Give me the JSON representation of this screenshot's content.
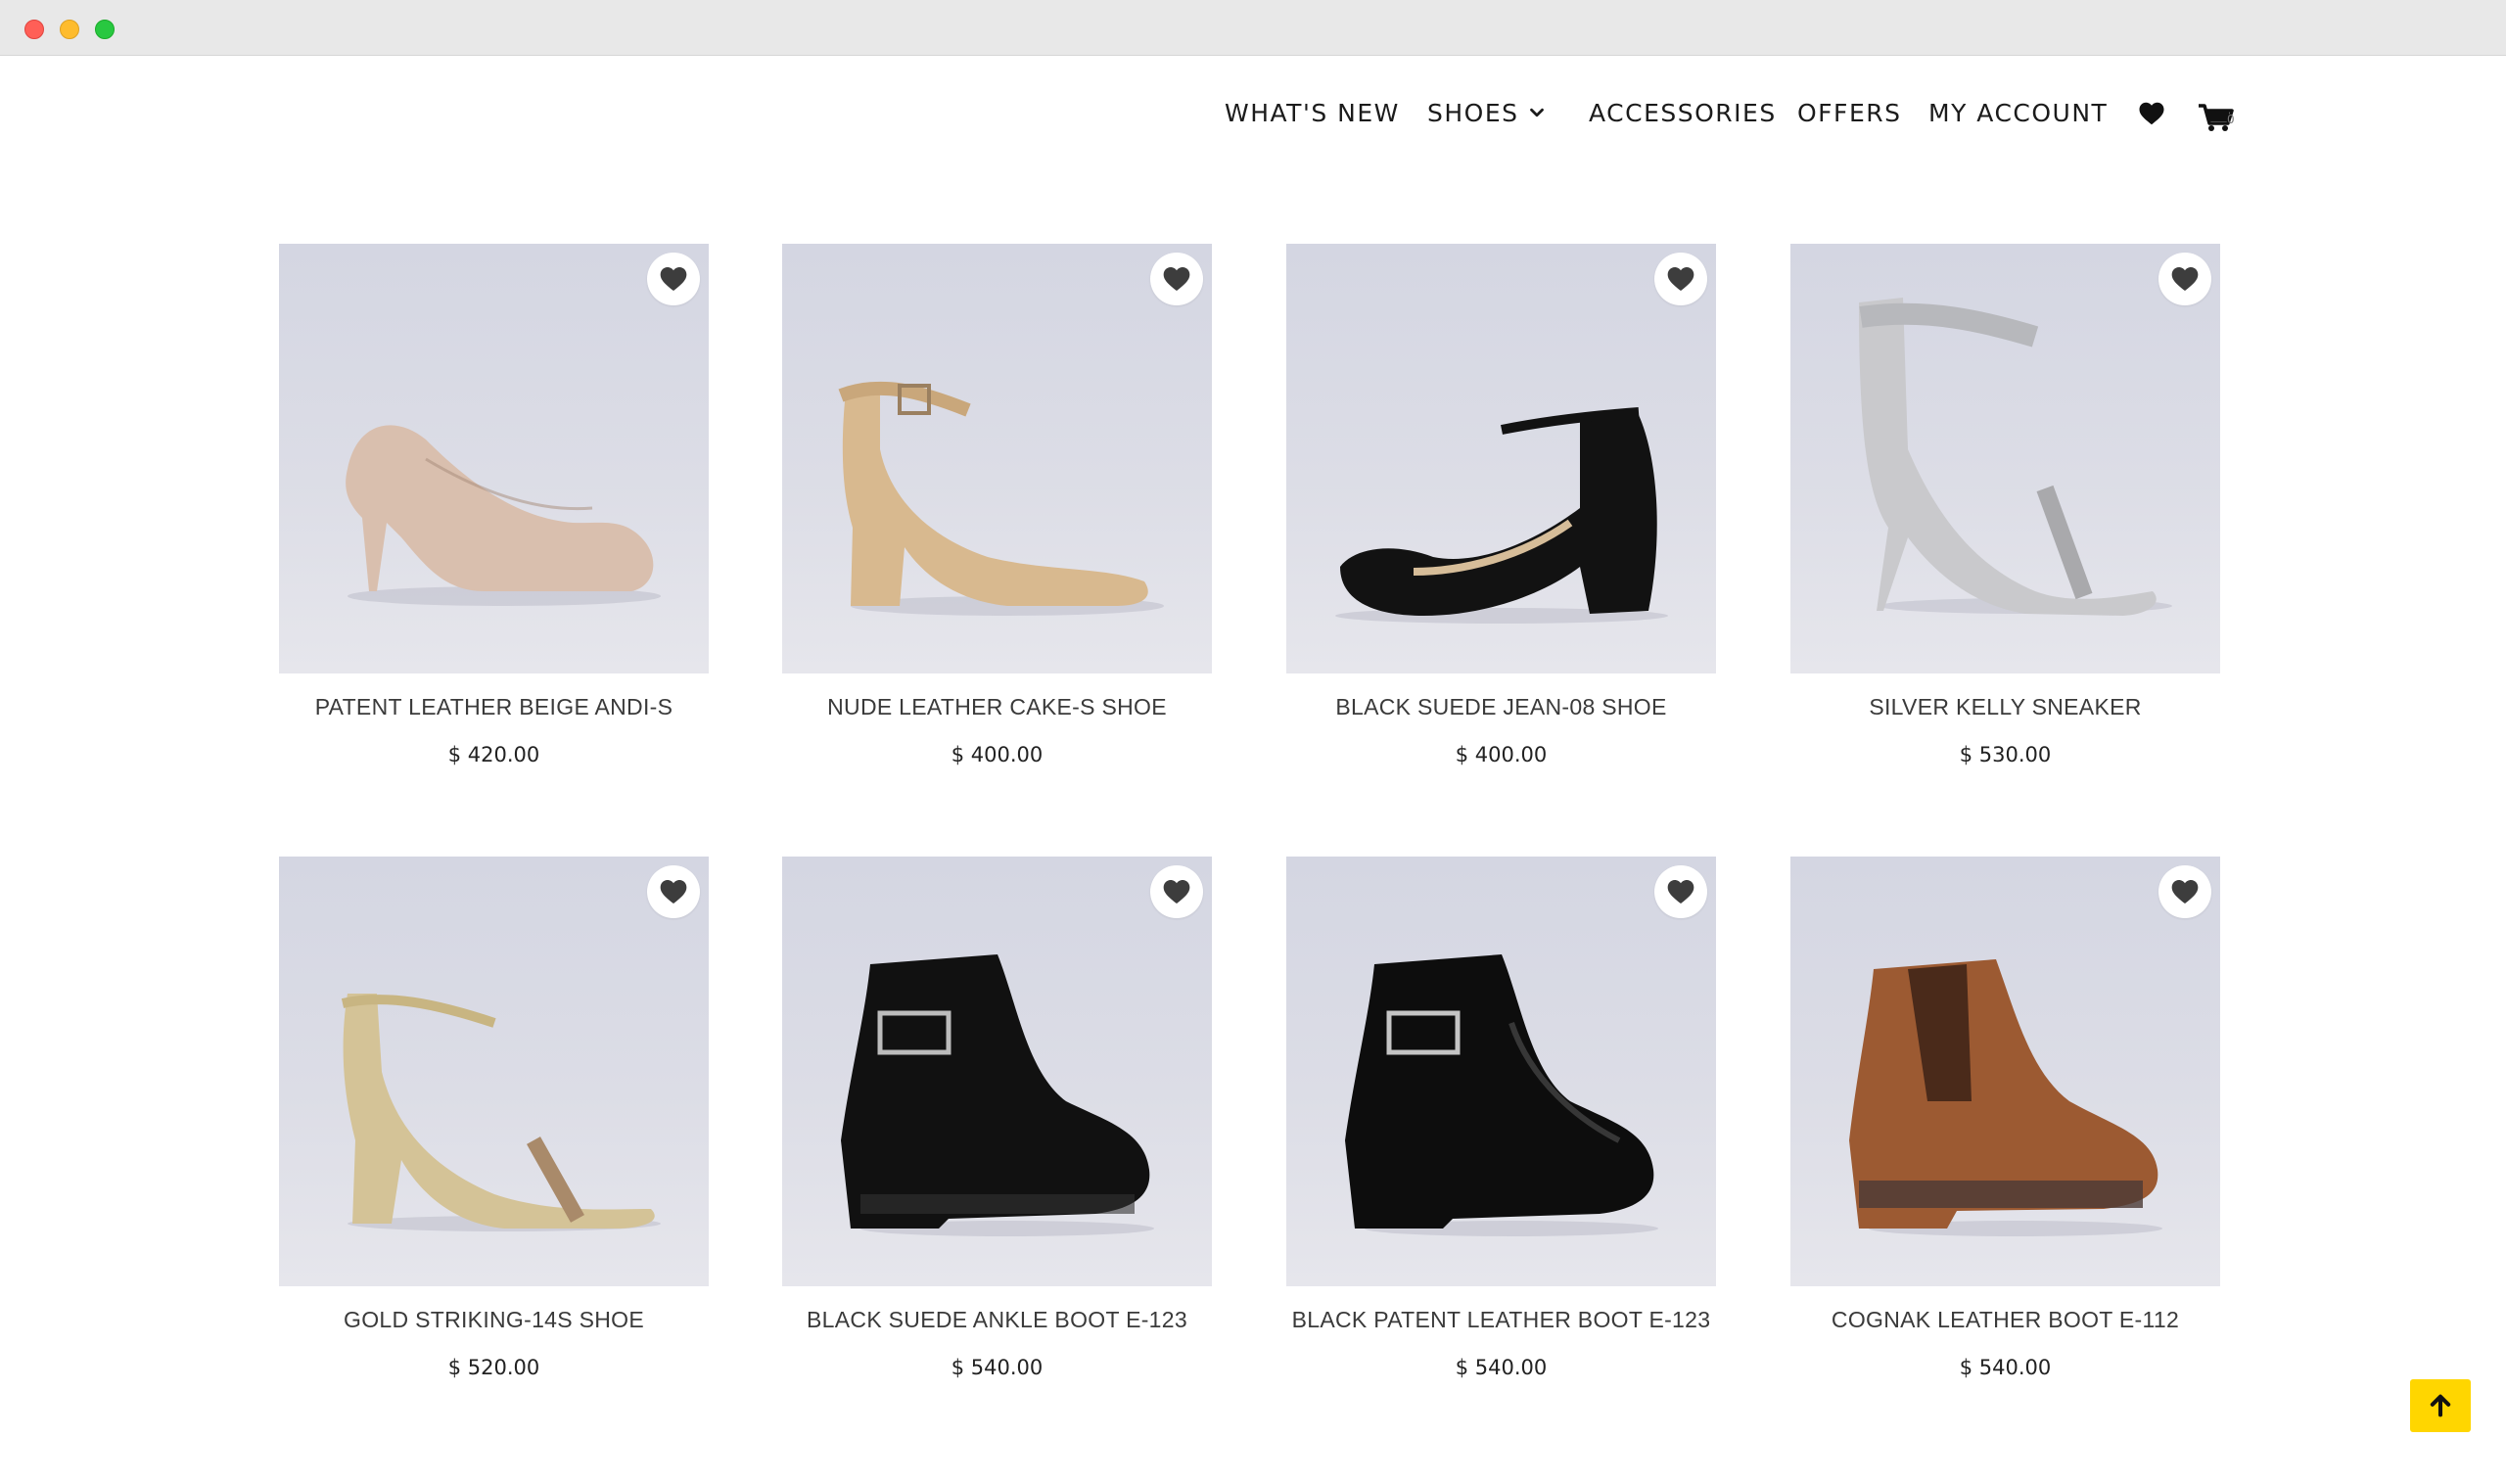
{
  "window": {
    "controls": [
      "close",
      "minimize",
      "zoom"
    ]
  },
  "nav": {
    "items": [
      {
        "label": "WHAT'S NEW"
      },
      {
        "label": "SHOES"
      },
      {
        "label": "ACCESSORIES"
      },
      {
        "label": "OFFERS"
      },
      {
        "label": "MY ACCOUNT"
      }
    ],
    "wishlist_icon": "heart-icon",
    "cart_icon": "cart-icon",
    "cart_count": "0"
  },
  "products": [
    {
      "name": "PATENT LEATHER BEIGE ANDI-S",
      "price": "$ 420.00",
      "shoe_color": "#d9bfae"
    },
    {
      "name": "NUDE LEATHER CAKE-S SHOE",
      "price": "$ 400.00",
      "shoe_color": "#d8b98f"
    },
    {
      "name": "BLACK SUEDE JEAN-08 SHOE",
      "price": "$ 400.00",
      "shoe_color": "#121212"
    },
    {
      "name": "SILVER KELLY SNEAKER",
      "price": "$ 530.00",
      "shoe_color": "#c9c9cc"
    },
    {
      "name": "GOLD STRIKING-14S SHOE",
      "price": "$ 520.00",
      "shoe_color": "#d4c397"
    },
    {
      "name": "BLACK SUEDE ANKLE BOOT E-123",
      "price": "$ 540.00",
      "shoe_color": "#111111"
    },
    {
      "name": "BLACK PATENT LEATHER BOOT E-123",
      "price": "$ 540.00",
      "shoe_color": "#0d0d0d"
    },
    {
      "name": "COGNAK LEATHER BOOT E-112",
      "price": "$ 540.00",
      "shoe_color": "#9c5a32"
    }
  ],
  "colors": {
    "accent_button": "#ffd600",
    "text": "#1b1b1b"
  }
}
